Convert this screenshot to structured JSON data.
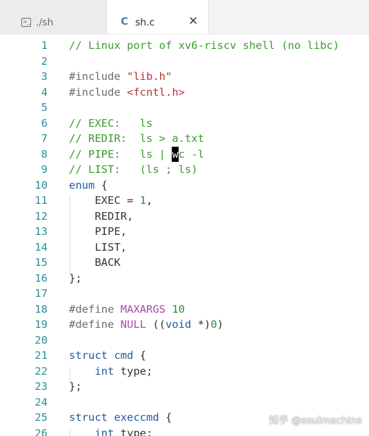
{
  "tabs": [
    {
      "label": "./sh",
      "icon": "terminal-icon",
      "active": false
    },
    {
      "label": "sh.c",
      "icon": "c-file-icon",
      "active": true,
      "icon_text": "C"
    }
  ],
  "close_glyph": "✕",
  "watermark": "知乎 @soulmachine",
  "colors": {
    "comment": "#3c9a2f",
    "keyword": "#1f5a9c",
    "macro": "#a64aa6",
    "string": "#b5323a",
    "line_number": "#2b8d96"
  },
  "lines": [
    {
      "n": "1",
      "tokens": [
        {
          "t": "// Linux port of xv6-riscv shell (no libc)",
          "k": "comment"
        }
      ]
    },
    {
      "n": "2",
      "tokens": []
    },
    {
      "n": "3",
      "tokens": [
        {
          "t": "#include ",
          "k": "directive"
        },
        {
          "t": "\"lib.h\"",
          "k": "string"
        }
      ]
    },
    {
      "n": "4",
      "tokens": [
        {
          "t": "#include ",
          "k": "directive"
        },
        {
          "t": "<fcntl.h>",
          "k": "header"
        }
      ]
    },
    {
      "n": "5",
      "tokens": []
    },
    {
      "n": "6",
      "tokens": [
        {
          "t": "// EXEC:   ls",
          "k": "comment"
        }
      ]
    },
    {
      "n": "7",
      "tokens": [
        {
          "t": "// REDIR:  ls > a.txt",
          "k": "comment"
        }
      ]
    },
    {
      "n": "8",
      "tokens": [
        {
          "t": "// PIPE:   ls | ",
          "k": "comment"
        },
        {
          "t": "w",
          "k": "cursor"
        },
        {
          "t": "c -l",
          "k": "comment"
        }
      ]
    },
    {
      "n": "9",
      "tokens": [
        {
          "t": "// LIST:   (ls ; ls)",
          "k": "comment"
        }
      ]
    },
    {
      "n": "10",
      "tokens": [
        {
          "t": "enum",
          "k": "keyword"
        },
        {
          "t": " {",
          "k": "punct"
        }
      ]
    },
    {
      "n": "11",
      "tokens": [
        {
          "t": "    EXEC = ",
          "k": "plain"
        },
        {
          "t": "1",
          "k": "number"
        },
        {
          "t": ",",
          "k": "punct"
        }
      ]
    },
    {
      "n": "12",
      "tokens": [
        {
          "t": "    REDIR,",
          "k": "plain"
        }
      ]
    },
    {
      "n": "13",
      "tokens": [
        {
          "t": "    PIPE,",
          "k": "plain"
        }
      ]
    },
    {
      "n": "14",
      "tokens": [
        {
          "t": "    LIST,",
          "k": "plain"
        }
      ]
    },
    {
      "n": "15",
      "tokens": [
        {
          "t": "    BACK",
          "k": "plain"
        }
      ]
    },
    {
      "n": "16",
      "tokens": [
        {
          "t": "};",
          "k": "punct"
        }
      ]
    },
    {
      "n": "17",
      "tokens": []
    },
    {
      "n": "18",
      "tokens": [
        {
          "t": "#define ",
          "k": "directive"
        },
        {
          "t": "MAXARGS",
          "k": "macro"
        },
        {
          "t": " ",
          "k": "plain"
        },
        {
          "t": "10",
          "k": "number"
        }
      ]
    },
    {
      "n": "19",
      "tokens": [
        {
          "t": "#define ",
          "k": "directive"
        },
        {
          "t": "NULL",
          "k": "macro"
        },
        {
          "t": " ((",
          "k": "punct"
        },
        {
          "t": "void",
          "k": "keyword"
        },
        {
          "t": " *)",
          "k": "punct"
        },
        {
          "t": "0",
          "k": "number"
        },
        {
          "t": ")",
          "k": "punct"
        }
      ]
    },
    {
      "n": "20",
      "tokens": []
    },
    {
      "n": "21",
      "tokens": [
        {
          "t": "struct",
          "k": "keyword"
        },
        {
          "t": " ",
          "k": "plain"
        },
        {
          "t": "cmd",
          "k": "type"
        },
        {
          "t": " {",
          "k": "punct"
        }
      ]
    },
    {
      "n": "22",
      "tokens": [
        {
          "t": "    ",
          "k": "plain"
        },
        {
          "t": "int",
          "k": "keyword"
        },
        {
          "t": " type;",
          "k": "plain"
        }
      ]
    },
    {
      "n": "23",
      "tokens": [
        {
          "t": "};",
          "k": "punct"
        }
      ]
    },
    {
      "n": "24",
      "tokens": []
    },
    {
      "n": "25",
      "tokens": [
        {
          "t": "struct",
          "k": "keyword"
        },
        {
          "t": " ",
          "k": "plain"
        },
        {
          "t": "execcmd",
          "k": "type"
        },
        {
          "t": " {",
          "k": "punct"
        }
      ]
    },
    {
      "n": "26",
      "tokens": [
        {
          "t": "    ",
          "k": "plain"
        },
        {
          "t": "int",
          "k": "keyword"
        },
        {
          "t": " type;",
          "k": "plain"
        }
      ]
    }
  ]
}
